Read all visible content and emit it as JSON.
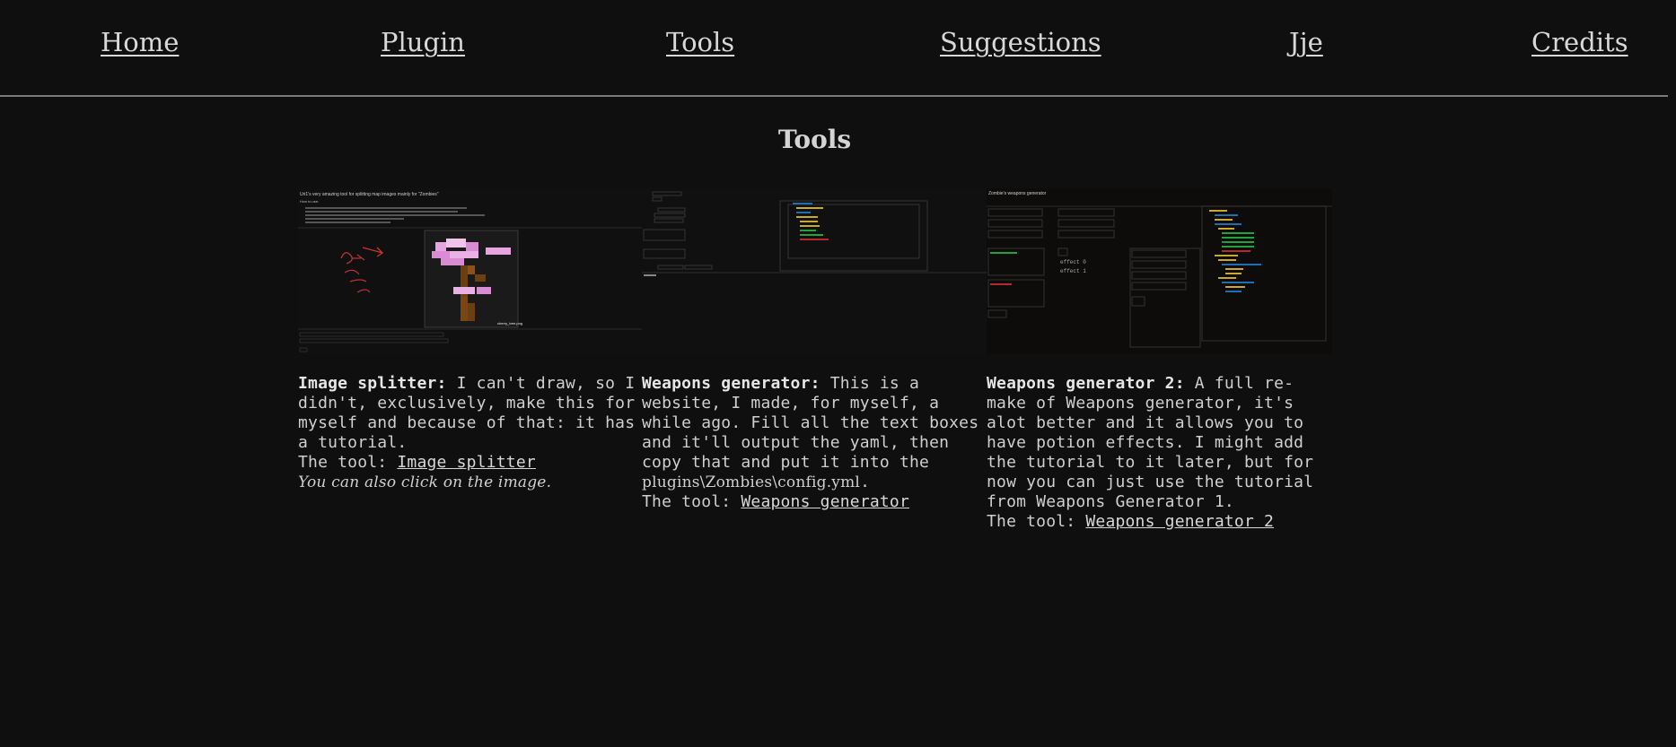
{
  "nav": {
    "items": [
      {
        "label": "Home"
      },
      {
        "label": "Plugin"
      },
      {
        "label": "Tools"
      },
      {
        "label": "Suggestions"
      },
      {
        "label": "Jje"
      },
      {
        "label": "Credits"
      }
    ]
  },
  "page": {
    "title": "Tools"
  },
  "tools": [
    {
      "name": "Image splitter:",
      "description": " I can't draw, so I didn't, exclusively, make this for myself and because of that: it has a tutorial.",
      "link_prefix": "The tool: ",
      "link_label": "Image splitter",
      "note": "You can also click on the image.",
      "thumb": {
        "heading": "Uri1's very amazing tool for splitting map images mainly for \"Zombies\"",
        "subheading": "How to use:",
        "file_label": "cherry_tree.png"
      }
    },
    {
      "name": "Weapons generator:",
      "description": " This is a website, I made, for myself, a while ago. Fill all the text boxes and it'll output the yaml, then copy that and put it into the ",
      "path": "plugins\\Zombies\\config.yml",
      "after_path": ".",
      "link_prefix": "The tool: ",
      "link_label": "Weapons generator"
    },
    {
      "name": "Weapons generator 2:",
      "description": " A full re-make of Weapons generator, it's alot better and it allows you to have potion effects. I might add the tutorial to it later, but for now you can just use the tutorial from Weapons Generator 1.",
      "link_prefix": "The tool: ",
      "link_label": "Weapons generator 2",
      "thumb": {
        "heading": "Zombie's weapons generator"
      }
    }
  ]
}
